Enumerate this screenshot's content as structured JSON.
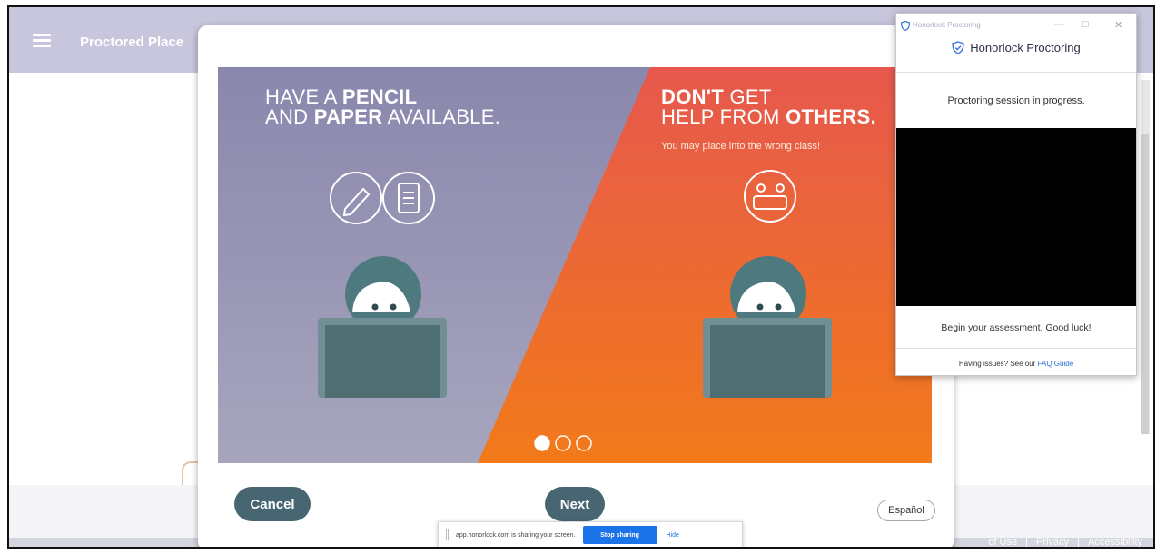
{
  "app": {
    "title": "Proctored Place",
    "footer_links": [
      "of Use",
      "|",
      "Privacy",
      "|",
      "Accessibility"
    ]
  },
  "modal": {
    "left_panel": {
      "line1_plain": "HAVE A ",
      "line1_bold": "PENCIL",
      "line2_plain_a": "AND ",
      "line2_bold": "PAPER",
      "line2_plain_b": " AVAILABLE.",
      "color": "#8e8cae"
    },
    "right_panel": {
      "line1_bold": "DON'T",
      "line1_plain": " GET",
      "line2_plain": "HELP FROM ",
      "line2_bold": "OTHERS.",
      "subtitle": "You may place into the wrong class!",
      "color": "#e8644a"
    },
    "pagination": {
      "total": 3,
      "active": 1
    },
    "cancel_label": "Cancel",
    "next_label": "Next",
    "language_label": "Español",
    "accent_color": "#476672"
  },
  "share_bar": {
    "text": "app.honorlock.com is sharing your screen.",
    "stop_label": "Stop sharing",
    "hide_label": "Hide"
  },
  "proctor": {
    "window_title": "Honorlock Proctoring",
    "brand": "Honorlock Proctoring",
    "status": "Proctoring session in progress.",
    "begin": "Begin your assessment. Good luck!",
    "help_prefix": "Having issues? See our ",
    "help_link": "FAQ Guide",
    "icons": [
      "shield-icon",
      "minimize-icon",
      "maximize-icon",
      "close-icon"
    ]
  }
}
